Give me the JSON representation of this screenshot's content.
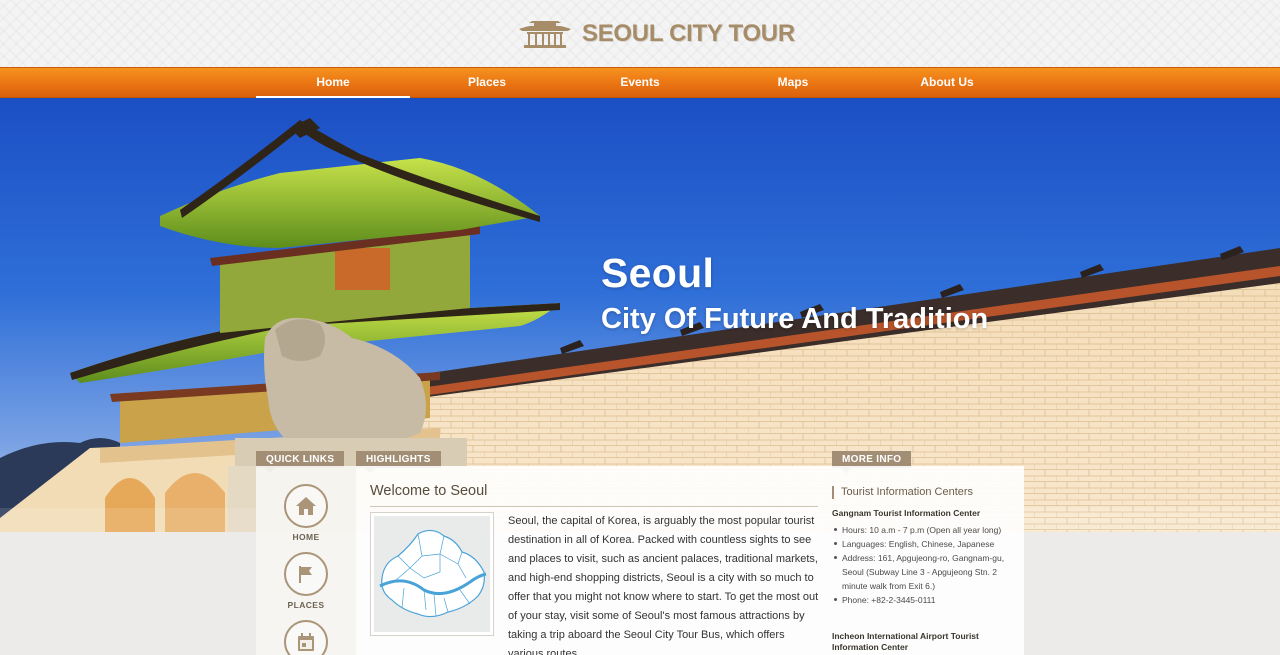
{
  "brand": {
    "name": "SEOUL CITY TOUR",
    "logo_icon": "palace-roof-icon"
  },
  "nav": {
    "items": [
      {
        "label": "Home",
        "active": true
      },
      {
        "label": "Places",
        "active": false
      },
      {
        "label": "Events",
        "active": false
      },
      {
        "label": "Maps",
        "active": false
      },
      {
        "label": "About Us",
        "active": false
      }
    ]
  },
  "hero": {
    "title": "Seoul",
    "subtitle": "City Of Future And Tradition"
  },
  "quick_links": {
    "tab_label": "QUICK LINKS",
    "items": [
      {
        "label": "HOME",
        "icon": "house-icon"
      },
      {
        "label": "PLACES",
        "icon": "flag-icon"
      },
      {
        "label": "",
        "icon": "calendar-icon"
      }
    ]
  },
  "highlights": {
    "tab_label": "HIGHLIGHTS",
    "title": "Welcome to Seoul",
    "map_icon": "seoul-district-map",
    "body": "Seoul, the capital of Korea, is arguably the most popular tourist destination in all of Korea. Packed with countless sights to see and places to visit, such as ancient palaces, traditional markets, and high-end shopping districts, Seoul is a city with so much to offer that you might not know where to start. To get the most out of your stay, visit some of Seoul's most famous attractions by taking a trip aboard the Seoul City Tour Bus, which offers various routes."
  },
  "more_info": {
    "tab_label": "MORE INFO",
    "heading": "Tourist Information Centers",
    "centers": [
      {
        "name": "Gangnam Tourist Information Center",
        "details": [
          "Hours: 10 a.m - 7 p.m (Open all year long)",
          "Languages: English, Chinese, Japanese",
          "Address: 161, Apgujeong-ro, Gangnam-gu, Seoul (Subway Line 3 - Apgujeong Stn. 2 minute walk from Exit 6.)",
          "Phone: +82-2-3445-0111"
        ]
      },
      {
        "name": "Incheon International Airport Tourist Information Center",
        "details": []
      }
    ]
  },
  "colors": {
    "nav_orange": "#ea7413",
    "brand_tan": "#a78c68",
    "tab_brown": "#a28e75",
    "sky_blue": "#2b63d1"
  }
}
